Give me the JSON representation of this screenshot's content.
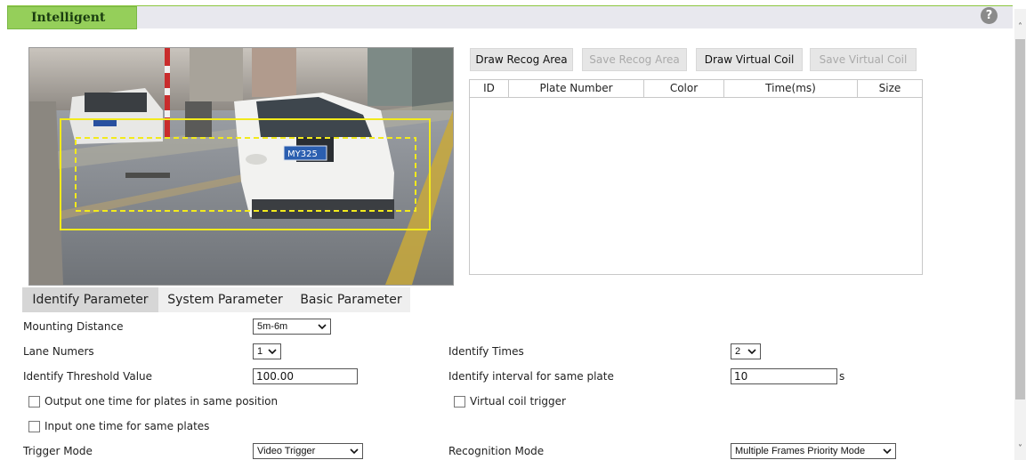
{
  "header": {
    "title": "Intelligent",
    "help_icon": "?"
  },
  "video": {
    "plate_text": "MY325"
  },
  "buttons": {
    "draw_recog_area": "Draw Recog Area",
    "save_recog_area": "Save Recog Area",
    "draw_virtual_coil": "Draw Virtual Coil",
    "save_virtual_coil": "Save Virtual Coil"
  },
  "table": {
    "columns": [
      "ID",
      "Plate Number",
      "Color",
      "Time(ms)",
      "Size"
    ]
  },
  "tabs": {
    "identify": "Identify Parameter",
    "system": "System Parameter",
    "basic": "Basic Parameter"
  },
  "form": {
    "mounting_distance": {
      "label": "Mounting Distance",
      "value": "5m-6m"
    },
    "lane_numbers": {
      "label": "Lane Numers",
      "value": "1"
    },
    "identify_times": {
      "label": "Identify Times",
      "value": "2"
    },
    "identify_threshold": {
      "label": "Identify Threshold Value",
      "value": "100.00"
    },
    "identify_interval": {
      "label": "Identify interval for same plate",
      "value": "10",
      "unit": "s"
    },
    "output_one_time": {
      "label": "Output one time for plates in same position",
      "checked": false
    },
    "virtual_coil_trigger": {
      "label": "Virtual coil trigger",
      "checked": false
    },
    "input_one_time": {
      "label": "Input one time for same plates",
      "checked": false
    },
    "trigger_mode": {
      "label": "Trigger Mode",
      "value": "Video Trigger"
    },
    "recognition_mode": {
      "label": "Recognition Mode",
      "value": "Multiple Frames Priority Mode"
    }
  },
  "colors": {
    "accent": "#95cf5a",
    "overlay": "#f2ea1c"
  },
  "icons": [
    "help-icon",
    "chevron-down-icon",
    "scroll-up-icon",
    "scroll-down-icon",
    "checkbox-icon"
  ]
}
